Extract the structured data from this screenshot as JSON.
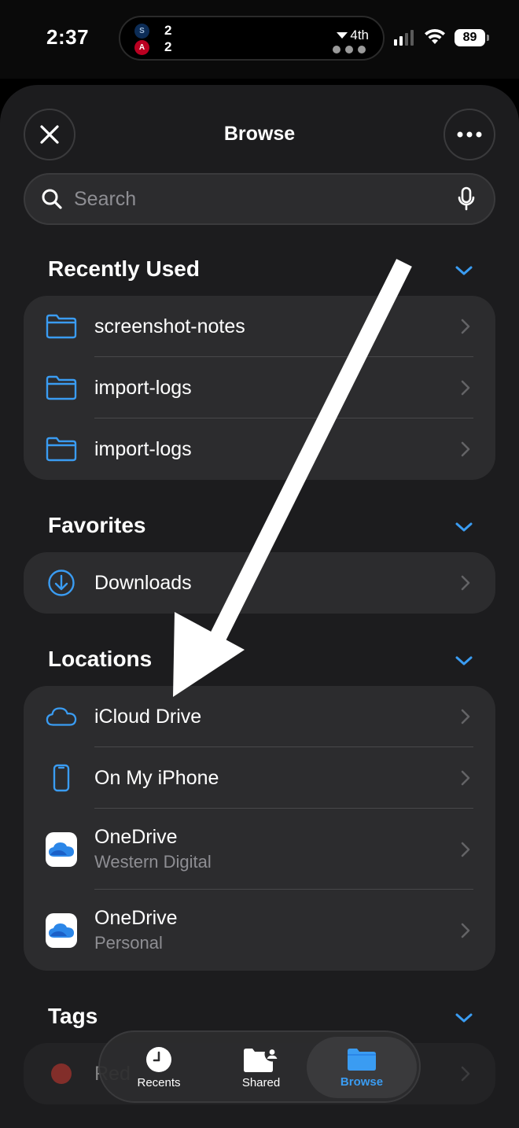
{
  "status_bar": {
    "time": "2:37",
    "live_activity": {
      "team1_score": "2",
      "team2_score": "2",
      "team1_logo": "S",
      "team2_logo": "A",
      "inning": "4th"
    },
    "battery": "89"
  },
  "header": {
    "title": "Browse"
  },
  "search": {
    "placeholder": "Search"
  },
  "sections": {
    "recently_used": {
      "title": "Recently Used",
      "items": [
        {
          "label": "screenshot-notes",
          "icon": "folder-icon"
        },
        {
          "label": "import-logs",
          "icon": "folder-icon"
        },
        {
          "label": "import-logs",
          "icon": "folder-icon"
        }
      ]
    },
    "favorites": {
      "title": "Favorites",
      "items": [
        {
          "label": "Downloads",
          "icon": "download-icon"
        }
      ]
    },
    "locations": {
      "title": "Locations",
      "items": [
        {
          "label": "iCloud Drive",
          "icon": "cloud-icon"
        },
        {
          "label": "On My iPhone",
          "icon": "phone-icon"
        },
        {
          "label": "OneDrive",
          "sublabel": "Western Digital",
          "icon": "onedrive-icon"
        },
        {
          "label": "OneDrive",
          "sublabel": "Personal",
          "icon": "onedrive-icon"
        }
      ]
    },
    "tags": {
      "title": "Tags",
      "items": [
        {
          "label": "Red",
          "color": "#ff453a"
        }
      ]
    }
  },
  "tab_bar": {
    "tabs": [
      {
        "label": "Recents",
        "icon": "clock-icon"
      },
      {
        "label": "Shared",
        "icon": "shared-folder-icon"
      },
      {
        "label": "Browse",
        "icon": "folder-icon",
        "active": true
      }
    ]
  },
  "colors": {
    "accent": "#3a9cf2",
    "background": "#1c1c1e",
    "cell": "#2c2c2e"
  }
}
